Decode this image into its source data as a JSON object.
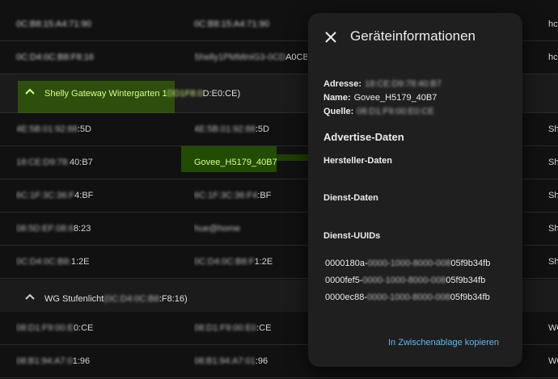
{
  "rows_top": [
    {
      "mac": "0C:B8:15:A4:71:90",
      "name": "0C:B8:15:A4:71:90",
      "extra": "hc"
    },
    {
      "mac": "0C:D4:0C:B8:F8:16",
      "name_prefix": "Shelly1PMMiniG3-0CD",
      "name_suffix": "A0CB8F8",
      "extra": "hc"
    }
  ],
  "group1": {
    "title_prefix": "Shelly Gateway Wintergarten 1",
    "title_blur": "DD1F8:0",
    "title_suffix": "D:E0:CE)"
  },
  "rows_mid": [
    {
      "mac_prefix": "4E:5B:0",
      "mac_blur": "1:92:88",
      "mac_suffix": ":5D",
      "name_prefix": "4E:5B:0",
      "name_blur": "1:92:88",
      "name_suffix": ":5D",
      "extra": "Sh"
    },
    {
      "mac_prefix": "",
      "mac_blur": "18:CE:D9:78:",
      "mac_suffix": "40:B7",
      "name": "Govee_H5179_40B7",
      "extra": "Sh"
    },
    {
      "mac_prefix": "",
      "mac_blur": "6C:1F:3C:36:F",
      "mac_suffix": "4:BF",
      "name_prefix": "",
      "name_blur": "6C:1F:3C:36:F4",
      "name_suffix": ":BF",
      "extra": "Sh"
    },
    {
      "mac_prefix": "",
      "mac_blur": "08:5D:EF:08:6",
      "mac_suffix": "8:23",
      "name_prefix": "",
      "name_blur": "hue@home",
      "name_suffix": "",
      "extra": "Sh"
    },
    {
      "mac_prefix": "",
      "mac_blur": "0C:D4:0C:B8:",
      "mac_suffix": "1:2E",
      "name_prefix": "",
      "name_blur": "0C:D4:0C:B8:F",
      "name_suffix": "1:2E",
      "extra": "Sh"
    }
  ],
  "group2": {
    "title_prefix": "WG Stufenlicht",
    "title_blur": "(0C:D4:0C:B8",
    "title_suffix": ":F8:16)"
  },
  "rows_bottom": [
    {
      "mac_prefix": "",
      "mac_blur": "08:D1:F9:00:E",
      "mac_suffix": "0:CE",
      "name_prefix": "",
      "name_blur": "08:D1:F9:00:E0",
      "name_suffix": ":CE",
      "extra": "WG"
    },
    {
      "mac_prefix": "",
      "mac_blur": "08:B1:94:A7:0",
      "mac_suffix": "1:96",
      "name_prefix": "",
      "name_blur": "08:B1:94:A7:01",
      "name_suffix": ":96",
      "extra": "WG"
    }
  ],
  "dialog": {
    "title": "Geräteinformationen",
    "address_label": "Adresse:",
    "address_value": "18:CE:D9:78:40:B7",
    "name_label": "Name:",
    "name_value": "Govee_H5179_40B7",
    "source_label": "Quelle:",
    "source_value": "08:D1:F9:00:E0:CE",
    "advertise_heading": "Advertise-Daten",
    "manufacturer_label": "Hersteller-Daten",
    "service_label": "Dienst-Daten",
    "uuids_label": "Dienst-UUIDs",
    "uuids": [
      {
        "pre": "0000180a-",
        "mid": "0000-1000-8000-008",
        "post": "05f9b34fb"
      },
      {
        "pre": "0000fef5-",
        "mid": "0000-1000-8000-008",
        "post": "05f9b34fb"
      },
      {
        "pre": "0000ec88-",
        "mid": "0000-1000-8000-008",
        "post": "05f9b34fb"
      }
    ],
    "copy_label": "In Zwischenablage kopieren"
  }
}
